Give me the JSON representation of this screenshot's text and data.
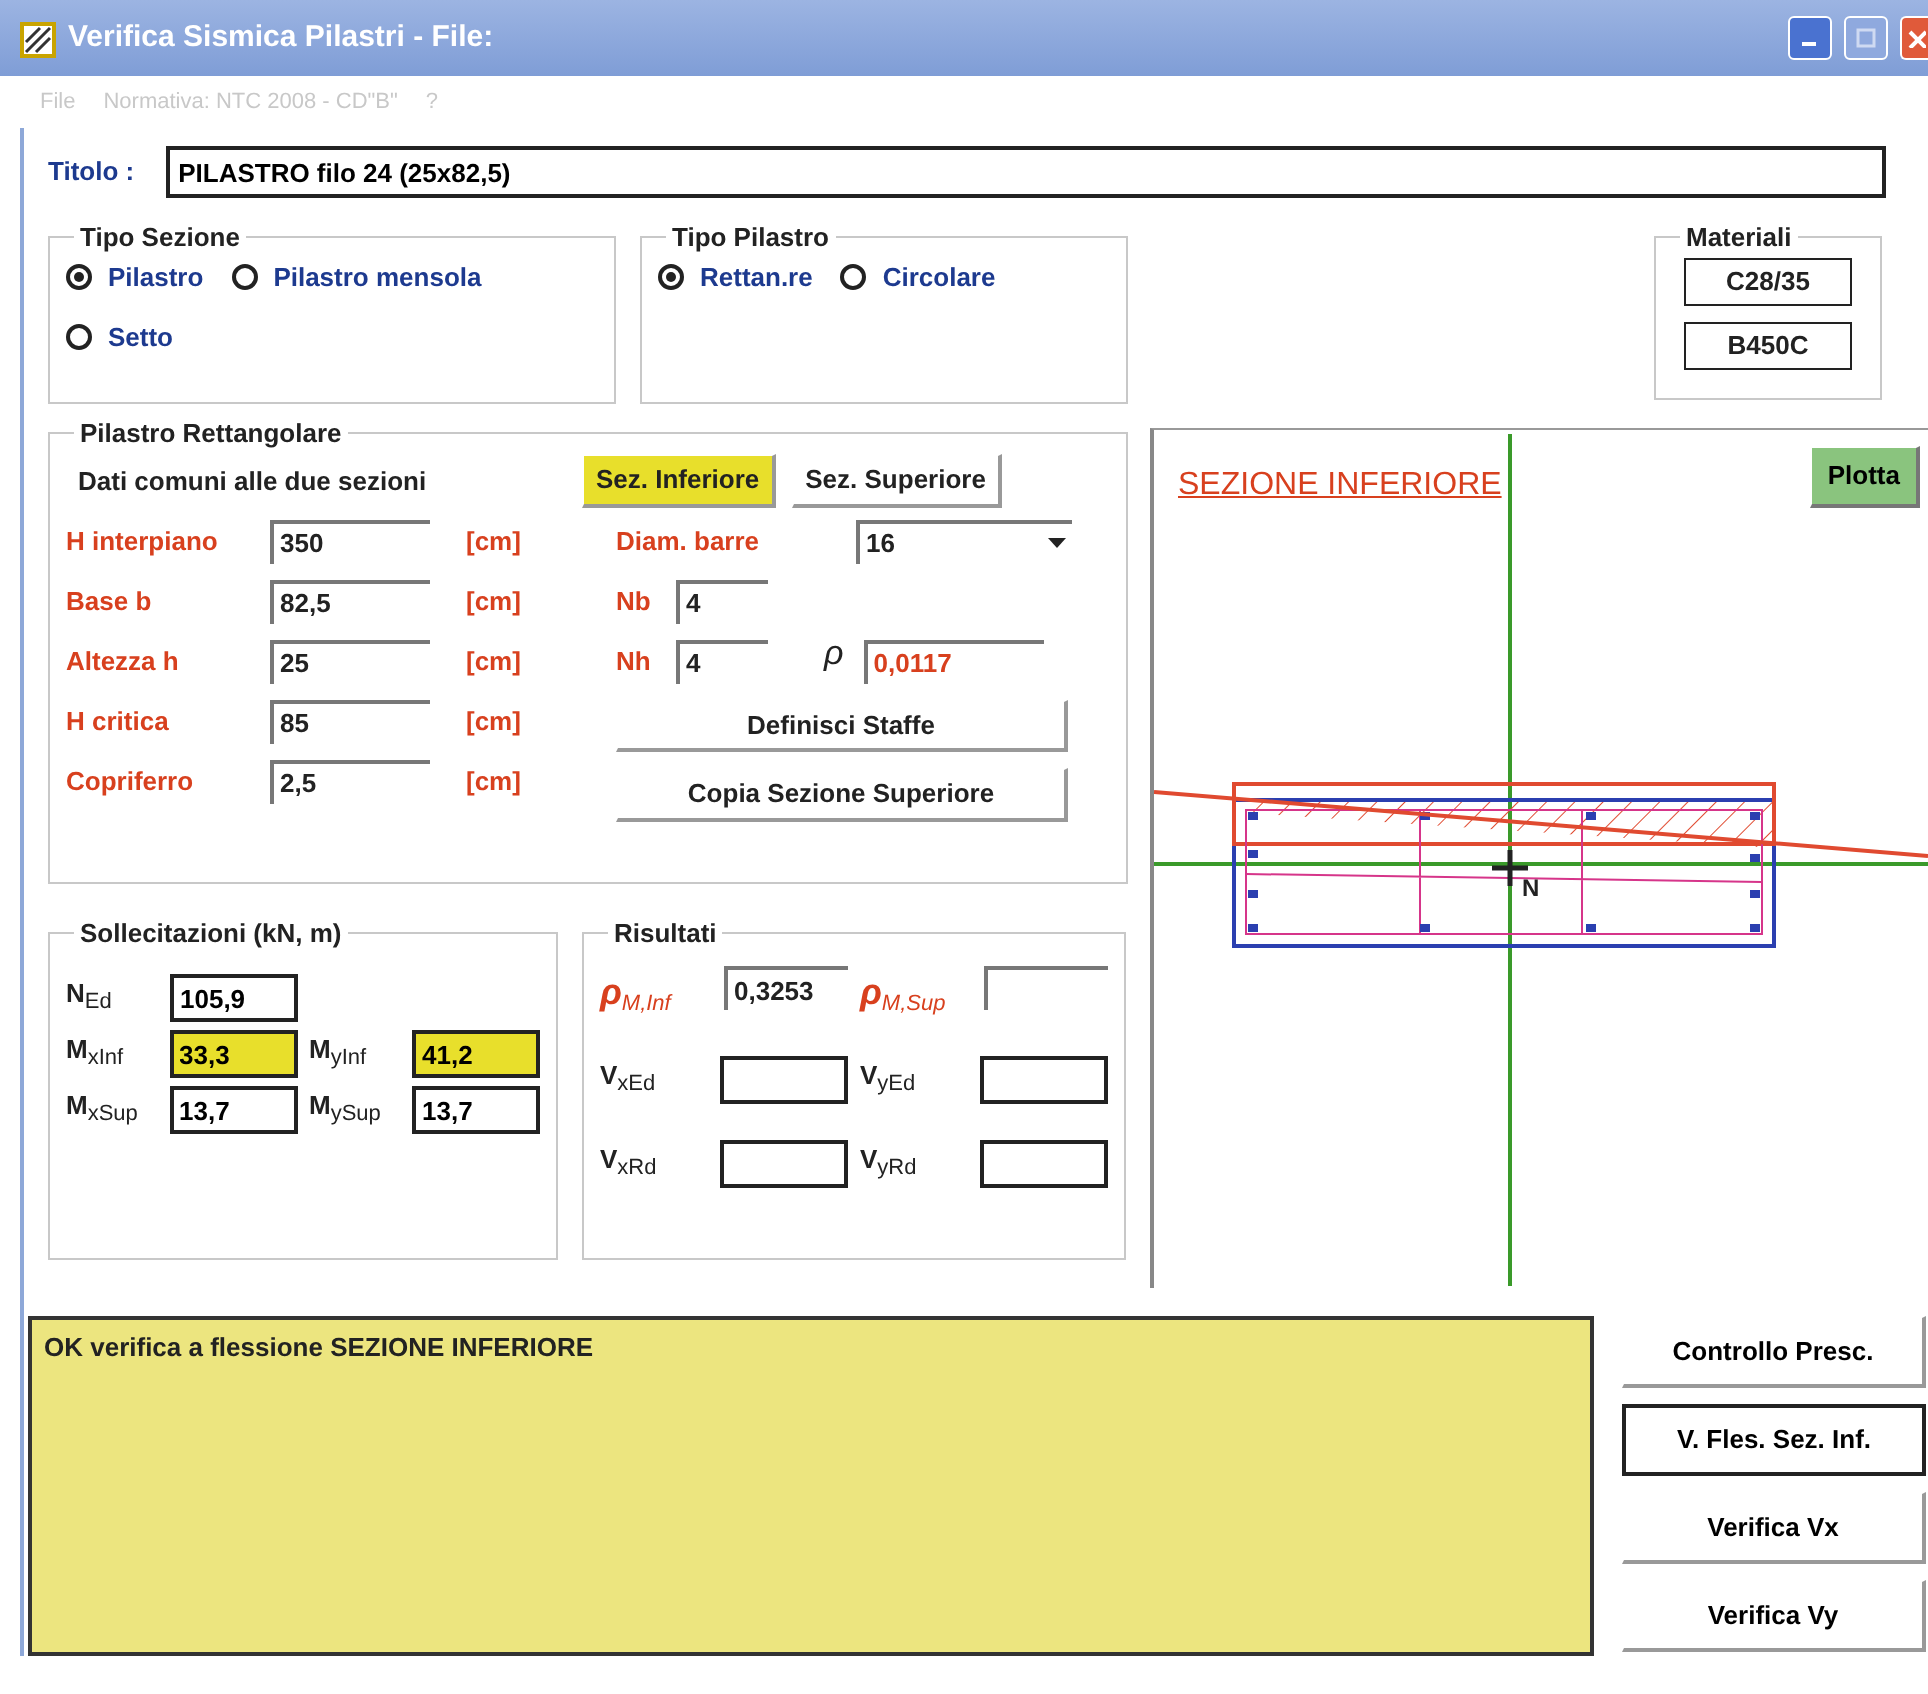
{
  "window": {
    "title": "Verifica Sismica Pilastri - File:"
  },
  "menu": [
    {
      "label": "File",
      "disabled": true
    },
    {
      "label": "Normativa: NTC 2008 - CD\"B\"",
      "disabled": true
    },
    {
      "label": "?",
      "disabled": true
    }
  ],
  "titolo": {
    "label": "Titolo :",
    "value": "PILASTRO filo 24 (25x82,5)"
  },
  "tipo_sezione": {
    "title": "Tipo Sezione",
    "options": [
      {
        "label": "Pilastro",
        "selected": true
      },
      {
        "label": "Pilastro mensola",
        "selected": false
      },
      {
        "label": "Setto",
        "selected": false
      }
    ]
  },
  "tipo_pilastro": {
    "title": "Tipo Pilastro",
    "options": [
      {
        "label": "Rettan.re",
        "selected": true
      },
      {
        "label": "Circolare",
        "selected": false
      }
    ]
  },
  "materiali": {
    "title": "Materiali",
    "values": [
      "C28/35",
      "B450C"
    ]
  },
  "pilastro_rettangolare": {
    "title": "Pilastro Rettangolare",
    "subtitle": "Dati comuni alle due sezioni",
    "section_buttons": [
      {
        "label": "Sez. Inferiore",
        "selected": true
      },
      {
        "label": "Sez. Superiore",
        "selected": false
      }
    ],
    "fields": [
      {
        "label": "H interpiano",
        "value": "350",
        "unit": "[cm]"
      },
      {
        "label": "Base b",
        "value": "82,5",
        "unit": "[cm]"
      },
      {
        "label": "Altezza h",
        "value": "25",
        "unit": "[cm]"
      },
      {
        "label": "H critica",
        "value": "85",
        "unit": "[cm]"
      },
      {
        "label": "Copriferro",
        "value": "2,5",
        "unit": "[cm]"
      }
    ],
    "diam_barre": {
      "label": "Diam. barre",
      "value": "16"
    },
    "nb": {
      "label": "Nb",
      "value": "4"
    },
    "nh": {
      "label": "Nh",
      "value": "4"
    },
    "rho": {
      "symbol": "ρ",
      "value": "0,0117"
    },
    "buttons": [
      "Definisci Staffe",
      "Copia Sezione Superiore"
    ]
  },
  "sollecitazioni": {
    "title": "Sollecitazioni (kN, m)",
    "rows": [
      [
        {
          "label": "N$_{Ed}$",
          "value": "105,9",
          "highlighted": false
        }
      ],
      [
        {
          "label": "M$_{xInf}$",
          "value": "33,3",
          "highlighted": true
        },
        {
          "label": "M$_{yInf}$",
          "value": "41,2",
          "highlighted": true
        }
      ],
      [
        {
          "label": "M$_{xSup}$",
          "value": "13,7",
          "highlighted": false
        },
        {
          "label": "M$_{ySup}$",
          "value": "13,7",
          "highlighted": false
        }
      ]
    ]
  },
  "risultati": {
    "title": "Risultati",
    "rows": [
      [
        {
          "kind": "rho",
          "label": "ρ$_{M,Inf}$",
          "value": "0,3253"
        },
        {
          "kind": "rho",
          "label": "ρ$_{M,Sup}$"
        }
      ],
      [
        {
          "kind": "box",
          "label": "V$_{xEd}$"
        },
        {
          "kind": "box",
          "label": "V$_{yEd}$"
        }
      ],
      [
        {
          "kind": "box",
          "label": "V$_{xRd}$"
        },
        {
          "kind": "box",
          "label": "V$_{yRd}$"
        }
      ]
    ]
  },
  "plot": {
    "title": "SEZIONE INFERIORE",
    "button": "Plotta",
    "point_label": "N"
  },
  "message": "OK verifica a flessione SEZIONE INFERIORE",
  "actions": [
    {
      "label": "Controllo Presc.",
      "focused": false
    },
    {
      "label": "V. Fles. Sez. Inf.",
      "focused": true
    },
    {
      "label": "Verifica Vx",
      "focused": false
    },
    {
      "label": "Verifica Vy",
      "focused": false
    }
  ]
}
